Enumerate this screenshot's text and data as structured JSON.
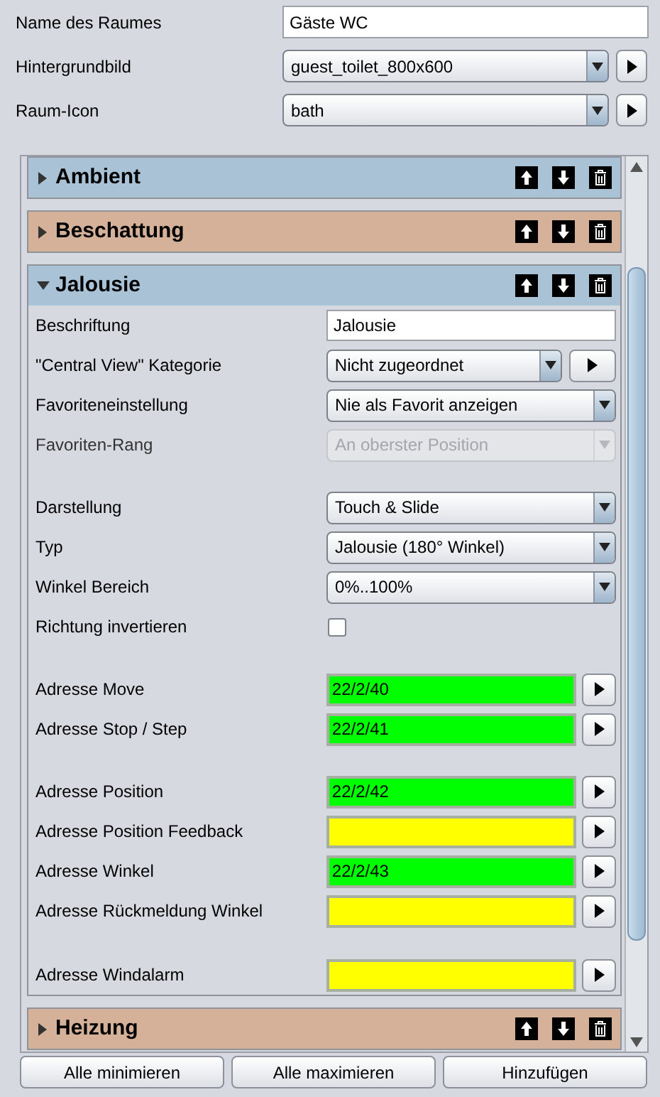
{
  "room_fields": [
    {
      "kind": "text",
      "label": "Name des Raumes",
      "value": "Gäste WC"
    },
    {
      "kind": "dropdown",
      "label": "Hintergrundbild",
      "value": "guest_toilet_800x600",
      "has_button": true
    },
    {
      "kind": "dropdown",
      "label": "Raum-Icon",
      "value": "bath",
      "has_button": true
    }
  ],
  "sections": [
    {
      "name": "Ambient",
      "color": "#a9c2d6",
      "expanded": false
    },
    {
      "name": "Beschattung",
      "color": "#d5b19a",
      "expanded": false
    },
    {
      "name": "Jalousie",
      "color": "#a9c2d6",
      "expanded": true,
      "groups": [
        [
          {
            "kind": "text",
            "label": "Beschriftung",
            "value": "Jalousie"
          },
          {
            "kind": "dropdown",
            "label": "\"Central View\" Kategorie",
            "value": "Nicht zugeordnet",
            "has_button": true,
            "disabled": false
          },
          {
            "kind": "dropdown",
            "label": "Favoriteneinstellung",
            "value": "Nie als Favorit anzeigen",
            "has_button": false,
            "disabled": false
          },
          {
            "kind": "dropdown",
            "label": "Favoriten-Rang",
            "value": "An oberster Position",
            "has_button": false,
            "disabled": true
          }
        ],
        [
          {
            "kind": "dropdown",
            "label": "Darstellung",
            "value": "Touch & Slide",
            "has_button": false,
            "disabled": false
          },
          {
            "kind": "dropdown",
            "label": "Typ",
            "value": "Jalousie (180° Winkel)",
            "has_button": false,
            "disabled": false
          },
          {
            "kind": "dropdown",
            "label": "Winkel Bereich",
            "value": "0%..100%",
            "has_button": false,
            "disabled": false
          },
          {
            "kind": "checkbox",
            "label": "Richtung invertieren",
            "checked": false
          }
        ],
        [
          {
            "kind": "address",
            "label": "Adresse Move",
            "value": "22/2/40",
            "color": "#00ff00"
          },
          {
            "kind": "address",
            "label": "Adresse Stop / Step",
            "value": "22/2/41",
            "color": "#00ff00"
          }
        ],
        [
          {
            "kind": "address",
            "label": "Adresse Position",
            "value": "22/2/42",
            "color": "#00ff00"
          },
          {
            "kind": "address",
            "label": "Adresse Position Feedback",
            "color": "#ffff00"
          },
          {
            "kind": "address",
            "label": "Adresse Winkel",
            "value": "22/2/43",
            "color": "#00ff00"
          },
          {
            "kind": "address",
            "label": "Adresse Rückmeldung Winkel",
            "color": "#ffff00"
          }
        ],
        [
          {
            "kind": "address",
            "label": "Adresse Windalarm",
            "color": "#ffff00"
          }
        ]
      ]
    },
    {
      "name": "Heizung",
      "color": "#d5b19a",
      "expanded": false
    }
  ],
  "buttons": [
    "Alle minimieren",
    "Alle maximieren",
    "Hinzufügen"
  ]
}
